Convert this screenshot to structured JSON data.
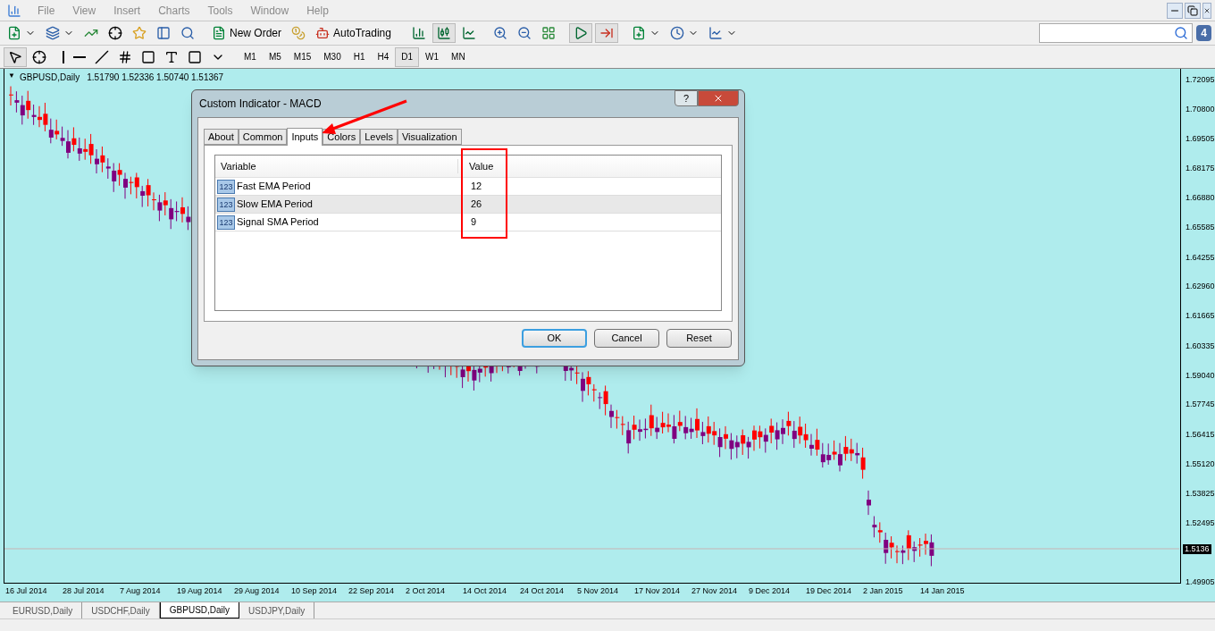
{
  "menu": [
    "File",
    "View",
    "Insert",
    "Charts",
    "Tools",
    "Window",
    "Help"
  ],
  "toolbar": {
    "new_order": "New Order",
    "autotrading": "AutoTrading"
  },
  "timeframes": [
    {
      "label": "M1",
      "selected": false
    },
    {
      "label": "M5",
      "selected": false
    },
    {
      "label": "M15",
      "selected": false
    },
    {
      "label": "M30",
      "selected": false
    },
    {
      "label": "H1",
      "selected": false
    },
    {
      "label": "H4",
      "selected": false
    },
    {
      "label": "D1",
      "selected": true
    },
    {
      "label": "W1",
      "selected": false
    },
    {
      "label": "MN",
      "selected": false
    }
  ],
  "notifications": {
    "count": "4"
  },
  "chart": {
    "menu_caret": "▼",
    "symbol": "GBPUSD,Daily",
    "ohlc": "1.51790 1.52336 1.50740 1.51367",
    "price_ticks": [
      "1.72095",
      "1.70800",
      "1.69505",
      "1.68175",
      "1.66880",
      "1.65585",
      "1.64255",
      "1.62960",
      "1.61665",
      "1.60335",
      "1.59040",
      "1.57745",
      "1.56415",
      "1.55120",
      "1.53825",
      "1.52495",
      "1.49905"
    ],
    "current_price": "1.5136",
    "date_ticks": [
      "16 Jul 2014",
      "28 Jul 2014",
      "7 Aug 2014",
      "19 Aug 2014",
      "29 Aug 2014",
      "10 Sep 2014",
      "22 Sep 2014",
      "2 Oct 2014",
      "14 Oct 2014",
      "24 Oct 2014",
      "5 Nov 2014",
      "17 Nov 2014",
      "27 Nov 2014",
      "9 Dec 2014",
      "19 Dec 2014",
      "2 Jan 2015",
      "14 Jan 2015"
    ]
  },
  "dialog": {
    "title": "Custom Indicator - MACD",
    "help": "?",
    "tabs": [
      {
        "label": "About",
        "selected": false
      },
      {
        "label": "Common",
        "selected": false
      },
      {
        "label": "Inputs",
        "selected": true
      },
      {
        "label": "Colors",
        "selected": false
      },
      {
        "label": "Levels",
        "selected": false
      },
      {
        "label": "Visualization",
        "selected": false
      }
    ],
    "columns": [
      "Variable",
      "Value"
    ],
    "rows": [
      {
        "type_badge": "123",
        "variable": "Fast EMA Period",
        "value": "12",
        "selected": false
      },
      {
        "type_badge": "123",
        "variable": "Slow EMA Period",
        "value": "26",
        "selected": true
      },
      {
        "type_badge": "123",
        "variable": "Signal SMA Period",
        "value": "9",
        "selected": false
      }
    ],
    "buttons": [
      {
        "label": "OK",
        "default": true
      },
      {
        "label": "Cancel",
        "default": false
      },
      {
        "label": "Reset",
        "default": false
      }
    ]
  },
  "chart_tabs": [
    {
      "label": "EURUSD,Daily",
      "selected": false
    },
    {
      "label": "USDCHF,Daily",
      "selected": false
    },
    {
      "label": "GBPUSD,Daily",
      "selected": true
    },
    {
      "label": "USDJPY,Daily",
      "selected": false
    }
  ]
}
